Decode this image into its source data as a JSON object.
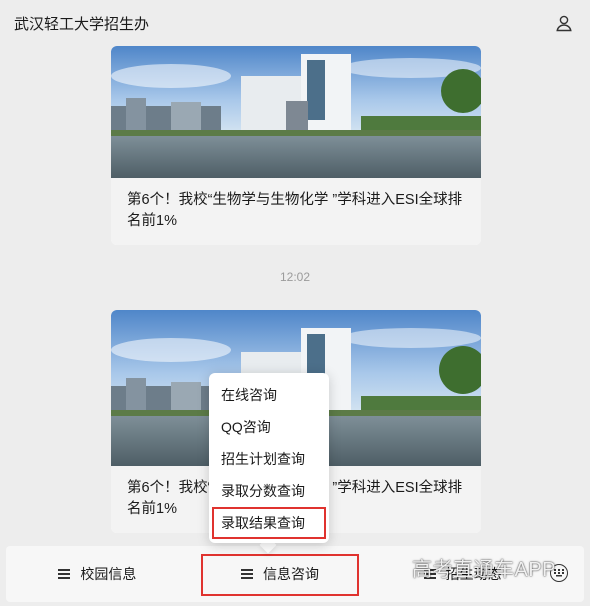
{
  "header": {
    "title": "武汉轻工大学招生办"
  },
  "messages": [
    {
      "title": "第6个！我校“生物学与生物化学 ”学科进入ESI全球排名前1%"
    },
    {
      "title": "第6个！我校“生物学与生物化学 ”学科进入ESI全球排名前1%"
    }
  ],
  "timestamp": "12:02",
  "menu": {
    "items": [
      {
        "label": "校园信息"
      },
      {
        "label": "信息咨询"
      },
      {
        "label": "招生动态"
      }
    ]
  },
  "submenu": {
    "items": [
      {
        "label": "在线咨询"
      },
      {
        "label": "QQ咨询"
      },
      {
        "label": "招生计划查询"
      },
      {
        "label": "录取分数查询"
      },
      {
        "label": "录取结果查询"
      }
    ]
  },
  "watermark": "高考直通车APP",
  "colors": {
    "background": "#ededed",
    "highlight": "#e0332f"
  },
  "icons": {
    "profile": "person-icon",
    "menu": "hamburger-icon",
    "keyboard": "keyboard-icon"
  }
}
